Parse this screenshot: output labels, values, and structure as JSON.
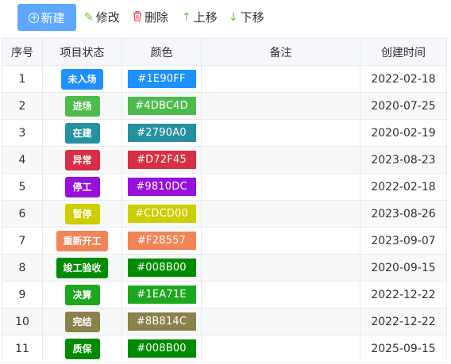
{
  "toolbar": {
    "new_label": "新建",
    "new_icon": "plus-circle-icon",
    "edit_label": "修改",
    "edit_icon": "pencil-icon",
    "delete_label": "删除",
    "delete_icon": "trash-icon",
    "up_label": "上移",
    "up_icon": "arrow-up-icon",
    "down_label": "下移",
    "down_icon": "arrow-down-icon",
    "accent": "#5EA8FF"
  },
  "table": {
    "headers": [
      "序号",
      "项目状态",
      "颜色",
      "备注",
      "创建时间"
    ],
    "rows": [
      {
        "index": "1",
        "status": "未入场",
        "color": "#1E90FF",
        "note": "",
        "created": "2022-02-18"
      },
      {
        "index": "2",
        "status": "进场",
        "color": "#4DBC4D",
        "note": "",
        "created": "2020-07-25"
      },
      {
        "index": "3",
        "status": "在建",
        "color": "#2790A0",
        "note": "",
        "created": "2020-02-19"
      },
      {
        "index": "4",
        "status": "异常",
        "color": "#D72F45",
        "note": "",
        "created": "2023-08-23"
      },
      {
        "index": "5",
        "status": "停工",
        "color": "#9810DC",
        "note": "",
        "created": "2022-02-18"
      },
      {
        "index": "6",
        "status": "暂停",
        "color": "#CDCD00",
        "note": "",
        "created": "2023-08-26"
      },
      {
        "index": "7",
        "status": "重新开工",
        "color": "#F28557",
        "note": "",
        "created": "2023-09-07"
      },
      {
        "index": "8",
        "status": "竣工验收",
        "color": "#008B00",
        "note": "",
        "created": "2020-09-15"
      },
      {
        "index": "9",
        "status": "决算",
        "color": "#1EA71E",
        "note": "",
        "created": "2022-12-22"
      },
      {
        "index": "10",
        "status": "完结",
        "color": "#8B814C",
        "note": "",
        "created": "2022-12-22"
      },
      {
        "index": "11",
        "status": "质保",
        "color": "#008B00",
        "note": "",
        "created": "2025-09-15"
      }
    ]
  }
}
